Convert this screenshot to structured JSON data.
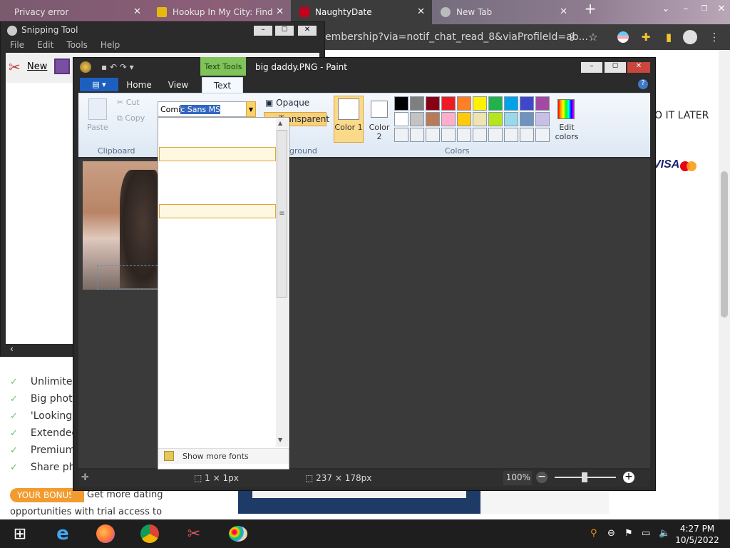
{
  "chrome": {
    "tabs": [
      {
        "title": "Privacy error"
      },
      {
        "title": "Hookup In My City: Find"
      },
      {
        "title": "NaughtyDate"
      },
      {
        "title": "New Tab"
      }
    ],
    "url": "embership?via=notif_chat_read_8&viaProfileId=ab..."
  },
  "webpage": {
    "right_text": "O IT LATER",
    "visa": "VISA",
    "features": [
      "Unlimited",
      "Big photo",
      "'Looking",
      "Extended",
      "Premium",
      "Share ph"
    ],
    "bonus_badge": "YOUR BONUS:",
    "bonus_text": "Get more dating",
    "bonus_text2": "opportunities with trial access to"
  },
  "snipping_tool": {
    "title": "Snipping Tool",
    "menu": [
      "File",
      "Edit",
      "Tools",
      "Help"
    ],
    "new_label": "New"
  },
  "paint": {
    "title": "big daddy.PNG - Paint",
    "context_tab": "Text Tools",
    "tabs": [
      "Home",
      "View",
      "Text"
    ],
    "clipboard": {
      "paste": "Paste",
      "cut": "Cut",
      "copy": "Copy",
      "group": "Clipboard"
    },
    "font": {
      "typed": "Comi",
      "selected": "c Sans MS"
    },
    "background": {
      "opaque": "Opaque",
      "transparent": "Transparent",
      "group_partial": "ground"
    },
    "color1": "Color 1",
    "color2": "Color 2",
    "colors_group": "Colors",
    "edit_colors": "Edit colors",
    "palette": [
      "#000000",
      "#7f7f7f",
      "#880015",
      "#ed1c24",
      "#ff7f27",
      "#fff200",
      "#22b14c",
      "#00a2e8",
      "#3f48cc",
      "#a349a4",
      "#ffffff",
      "#c3c3c3",
      "#b97a57",
      "#ffaec9",
      "#ffc90e",
      "#efe4b0",
      "#b5e61d",
      "#99d9ea",
      "#7092be",
      "#c8bfe7",
      "#eef1f6",
      "#eef1f6",
      "#eef1f6",
      "#eef1f6",
      "#eef1f6",
      "#eef1f6",
      "#eef1f6",
      "#eef1f6",
      "#eef1f6",
      "#eef1f6"
    ],
    "show_more_fonts": "Show more fonts",
    "status": {
      "cursor": "1 × 1px",
      "size": "237 × 178px",
      "zoom": "100%"
    }
  },
  "taskbar": {
    "time": "4:27 PM",
    "date": "10/5/2022"
  }
}
